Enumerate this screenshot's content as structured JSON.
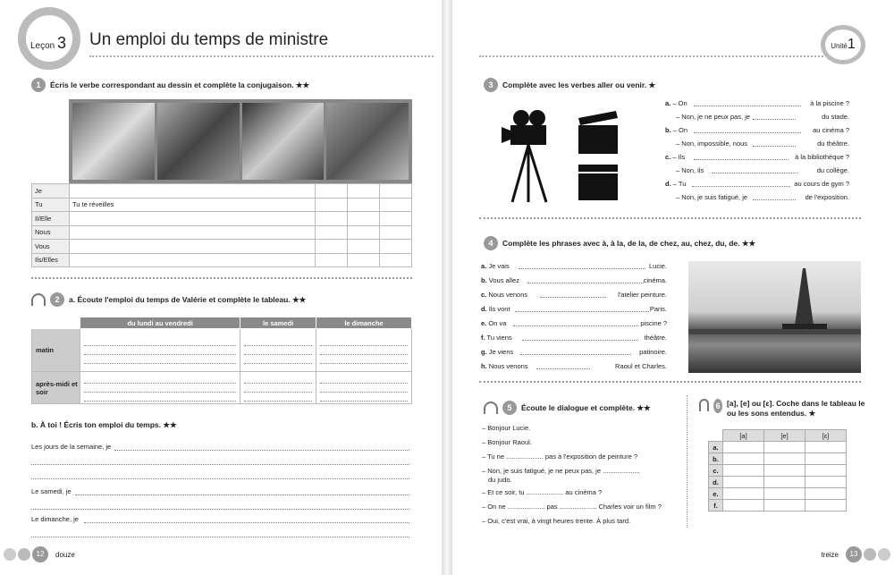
{
  "left_page": {
    "lesson_label": "Leçon",
    "lesson_number": "3",
    "title": "Un emploi du temps de ministre",
    "ex1": {
      "number": "1",
      "instruction": "Écris le verbe correspondant au dessin et complète la conjugaison. ★★",
      "pronouns": [
        "Je",
        "Tu",
        "Il/Elle",
        "Nous",
        "Vous",
        "Ils/Elles"
      ],
      "example": "Tu te réveilles"
    },
    "ex2": {
      "number": "2",
      "instruction_a": "a. Écoute l'emploi du temps de Valérie et complète le tableau. ★★",
      "columns": [
        "du lundi au vendredi",
        "le samedi",
        "le dimanche"
      ],
      "rows": [
        "matin",
        "après-midi et soir"
      ],
      "instruction_b": "b. À toi ! Écris ton emploi du temps. ★★",
      "prompts": [
        "Les jours de la semaine, je",
        "Le samedi, je",
        "Le dimanche, je"
      ]
    },
    "page_number": "12",
    "page_word": "douze"
  },
  "right_page": {
    "unit_label": "Unité",
    "unit_number": "1",
    "ex3": {
      "number": "3",
      "instruction": "Complète avec les verbes aller ou venir. ★",
      "items": [
        {
          "letter": "a.",
          "q": "– On",
          "q_end": "à la piscine ?",
          "a": "– Non, je ne peux pas, je",
          "a_end": "du stade."
        },
        {
          "letter": "b.",
          "q": "– On",
          "q_end": "au cinéma ?",
          "a": "– Non, impossible, nous",
          "a_end": "du théâtre."
        },
        {
          "letter": "c.",
          "q": "– Ils",
          "q_end": "à la bibliothèque ?",
          "a": "– Non, ils",
          "a_end": "du collège."
        },
        {
          "letter": "d.",
          "q": "– Tu",
          "q_end": "au cours de gym ?",
          "a": "– Non, je suis fatigué, je",
          "a_end": "de l'exposition."
        }
      ]
    },
    "ex4": {
      "number": "4",
      "instruction": "Complète les phrases avec à, à la, de la, de chez, au, chez, du, de. ★★",
      "items": [
        {
          "letter": "a.",
          "start": "Je vais",
          "end": "Lucie."
        },
        {
          "letter": "b.",
          "start": "Vous allez",
          "end": "cinéma."
        },
        {
          "letter": "c.",
          "start": "Nous venons",
          "end": "l'atelier peinture."
        },
        {
          "letter": "d.",
          "start": "Ils vont",
          "end": "Paris."
        },
        {
          "letter": "e.",
          "start": "On va",
          "end": "piscine ?"
        },
        {
          "letter": "f.",
          "start": "Tu viens",
          "end": "théâtre."
        },
        {
          "letter": "g.",
          "start": "Je viens",
          "end": "patinoire."
        },
        {
          "letter": "h.",
          "start": "Nous venons",
          "end": "Raoul et Charles."
        }
      ]
    },
    "ex5": {
      "number": "5",
      "instruction": "Écoute le dialogue et complète. ★★",
      "lines": [
        "– Bonjour Lucie.",
        "– Bonjour Raoul.",
        "– Tu ne .................... pas à l'exposition de peinture ?",
        "– Non, je suis fatigué, je ne peux pas, je ....................",
        "du judo.",
        "– Et ce soir, tu .................... au cinéma ?",
        "– On ne .................... pas .................... Charles voir un film ?",
        "– Oui, c'est vrai, à vingt heures trente. À plus tard."
      ]
    },
    "ex6": {
      "number": "6",
      "instruction": "[a], [e] ou [ɛ]. Coche dans le tableau le ou les sons entendus. ★",
      "columns": [
        "[a]",
        "[e]",
        "[ɛ]"
      ],
      "rows": [
        "a.",
        "b.",
        "c.",
        "d.",
        "e.",
        "f."
      ]
    },
    "page_word": "treize",
    "page_number": "13"
  }
}
